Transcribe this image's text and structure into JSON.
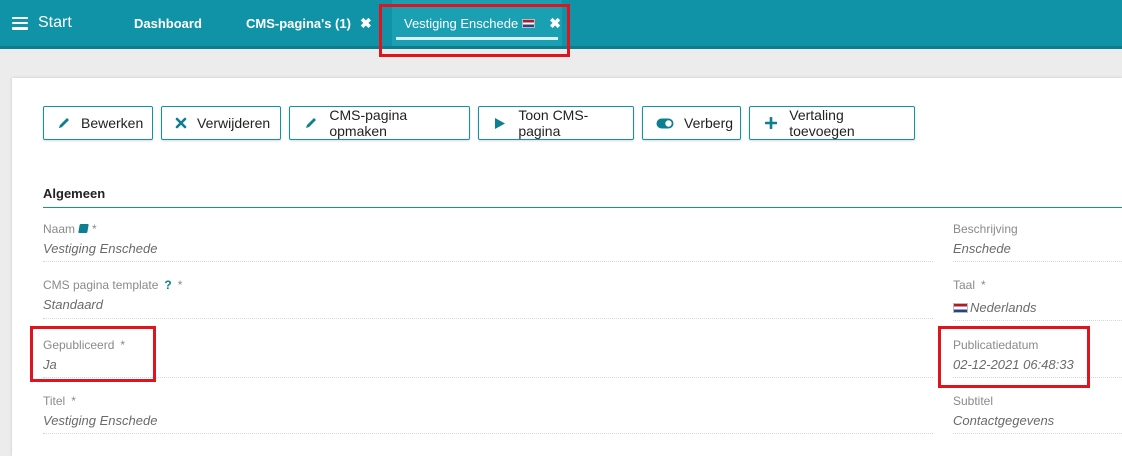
{
  "topbar": {
    "start_label": "Start",
    "tabs": [
      {
        "label": "Dashboard"
      },
      {
        "label": "CMS-pagina's (1)",
        "close": "✖"
      },
      {
        "label": "Vestiging Enschede",
        "close": "✖",
        "active": true
      }
    ]
  },
  "toolbar": {
    "buttons": [
      {
        "label": "Bewerken",
        "icon": "pencil-icon"
      },
      {
        "label": "Verwijderen",
        "icon": "x-icon"
      },
      {
        "label": "CMS-pagina opmaken",
        "icon": "pencil-icon"
      },
      {
        "label": "Toon CMS-pagina",
        "icon": "play-icon"
      },
      {
        "label": "Verberg",
        "icon": "toggle-icon"
      },
      {
        "label": "Vertaling toevoegen",
        "icon": "plus-icon"
      }
    ]
  },
  "section": {
    "title": "Algemeen"
  },
  "fields": {
    "naam": {
      "label": "Naam",
      "required": "*",
      "value": "Vestiging Enschede"
    },
    "beschrijving": {
      "label": "Beschrijving",
      "value": "Enschede"
    },
    "template": {
      "label": "CMS pagina template",
      "help": "?",
      "required": "*",
      "value": "Standaard"
    },
    "taal": {
      "label": "Taal",
      "required": "*",
      "value": "Nederlands"
    },
    "gepubliceerd": {
      "label": "Gepubliceerd",
      "required": "*",
      "value": "Ja"
    },
    "publicatiedatum": {
      "label": "Publicatiedatum",
      "value": "02-12-2021 06:48:33"
    },
    "titel": {
      "label": "Titel",
      "required": "*",
      "value": "Vestiging Enschede"
    },
    "subtitel": {
      "label": "Subtitel",
      "value": "Contactgegevens"
    }
  },
  "colors": {
    "accent": "#1193a7",
    "highlight": "#e0141e"
  }
}
